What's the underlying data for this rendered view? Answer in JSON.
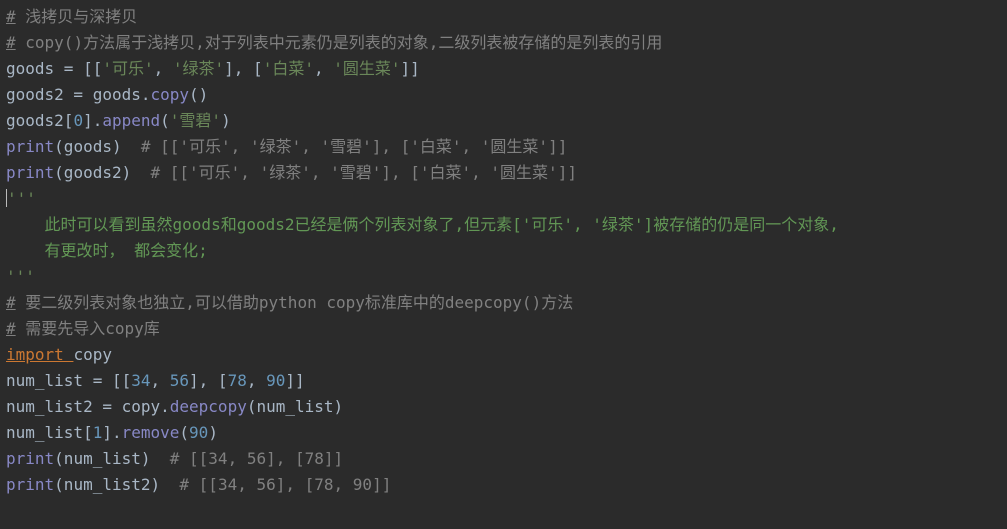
{
  "lines": {
    "l1_c1": "#",
    "l1_c2": " 浅拷贝与深拷贝",
    "l2_c1": "#",
    "l2_c2": " copy()方法属于浅拷贝,对于列表中元素仍是列表的对象,二级列表被存储的是列表的引用",
    "l3_a": "goods = [[",
    "l3_s1": "'可乐'",
    "l3_b": ", ",
    "l3_s2": "'绿茶'",
    "l3_c": "], [",
    "l3_s3": "'白菜'",
    "l3_d": ", ",
    "l3_s4": "'圆生菜'",
    "l3_e": "]]",
    "l4_a": "goods2 = goods.",
    "l4_f": "copy",
    "l4_b": "()",
    "l5_a": "goods2[",
    "l5_n": "0",
    "l5_b": "].",
    "l5_f": "append",
    "l5_c": "(",
    "l5_s": "'雪碧'",
    "l5_d": ")",
    "l6_f": "print",
    "l6_a": "(goods)  ",
    "l6_c": "# [['可乐', '绿茶', '雪碧'], ['白菜', '圆生菜']]",
    "l7_f": "print",
    "l7_a": "(goods2)  ",
    "l7_c": "# [['可乐', '绿茶', '雪碧'], ['白菜', '圆生菜']]",
    "l8_q": "'''",
    "l9_doc": "    此时可以看到虽然goods和goods2已经是俩个列表对象了,但元素['可乐', '绿茶']被存储的仍是同一个对象,",
    "l10_doc": "    有更改时， 都会变化;",
    "l11_q": "'''",
    "l12_c1": "#",
    "l12_c2": " 要二级列表对象也独立,可以借助python copy标准库中的deepcopy()方法",
    "l13_c1": "#",
    "l13_c2": " 需要先导入copy库",
    "l14_kw": "import ",
    "l14_m": "copy",
    "l15_a": "num_list = [[",
    "l15_n1": "34",
    "l15_b": ", ",
    "l15_n2": "56",
    "l15_c": "], [",
    "l15_n3": "78",
    "l15_d": ", ",
    "l15_n4": "90",
    "l15_e": "]]",
    "l16_a": "num_list2 = copy.",
    "l16_f": "deepcopy",
    "l16_b": "(num_list)",
    "l17_a": "num_list[",
    "l17_n": "1",
    "l17_b": "].",
    "l17_f": "remove",
    "l17_c": "(",
    "l17_n2": "90",
    "l17_d": ")",
    "l18_f": "print",
    "l18_a": "(num_list)  ",
    "l18_c": "# [[34, 56], [78]]",
    "l19_f": "print",
    "l19_a": "(num_list2)  ",
    "l19_c": "# [[34, 56], [78, 90]]"
  }
}
